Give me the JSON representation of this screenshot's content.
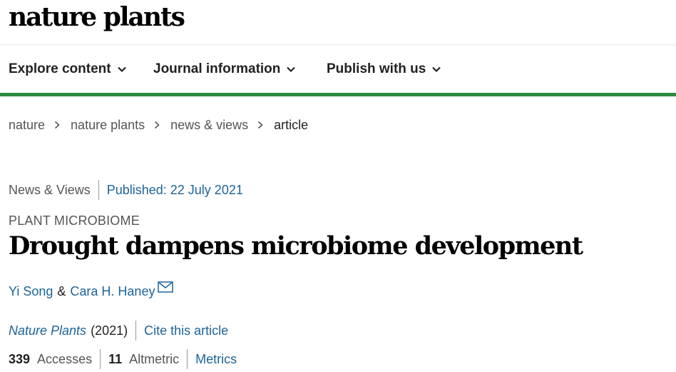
{
  "brand": {
    "logo_text": "nature plants"
  },
  "nav": {
    "items": [
      {
        "label": "Explore content"
      },
      {
        "label": "Journal information"
      },
      {
        "label": "Publish with us"
      }
    ]
  },
  "breadcrumb": {
    "items": [
      {
        "label": "nature"
      },
      {
        "label": "nature plants"
      },
      {
        "label": "news & views"
      },
      {
        "label": "article"
      }
    ]
  },
  "article": {
    "type": "News & Views",
    "published": "Published: 22 July 2021",
    "subject": "PLANT MICROBIOME",
    "title": "Drought dampens microbiome development",
    "authors": [
      "Yi Song",
      "Cara H. Haney"
    ],
    "author_joiner": "&",
    "journal": "Nature Plants",
    "year": "(2021)",
    "cite_label": "Cite this article",
    "accesses_count": "339",
    "accesses_label": "Accesses",
    "altmetric_count": "11",
    "altmetric_label": "Altmetric",
    "metrics_label": "Metrics"
  },
  "colors": {
    "link": "#1c6499",
    "accent_green": "#2b8a3e",
    "text": "#222222"
  },
  "icons": {
    "dropdown": "chevron-down-icon",
    "breadcrumb_separator": "chevron-right-icon",
    "email": "envelope-icon"
  }
}
